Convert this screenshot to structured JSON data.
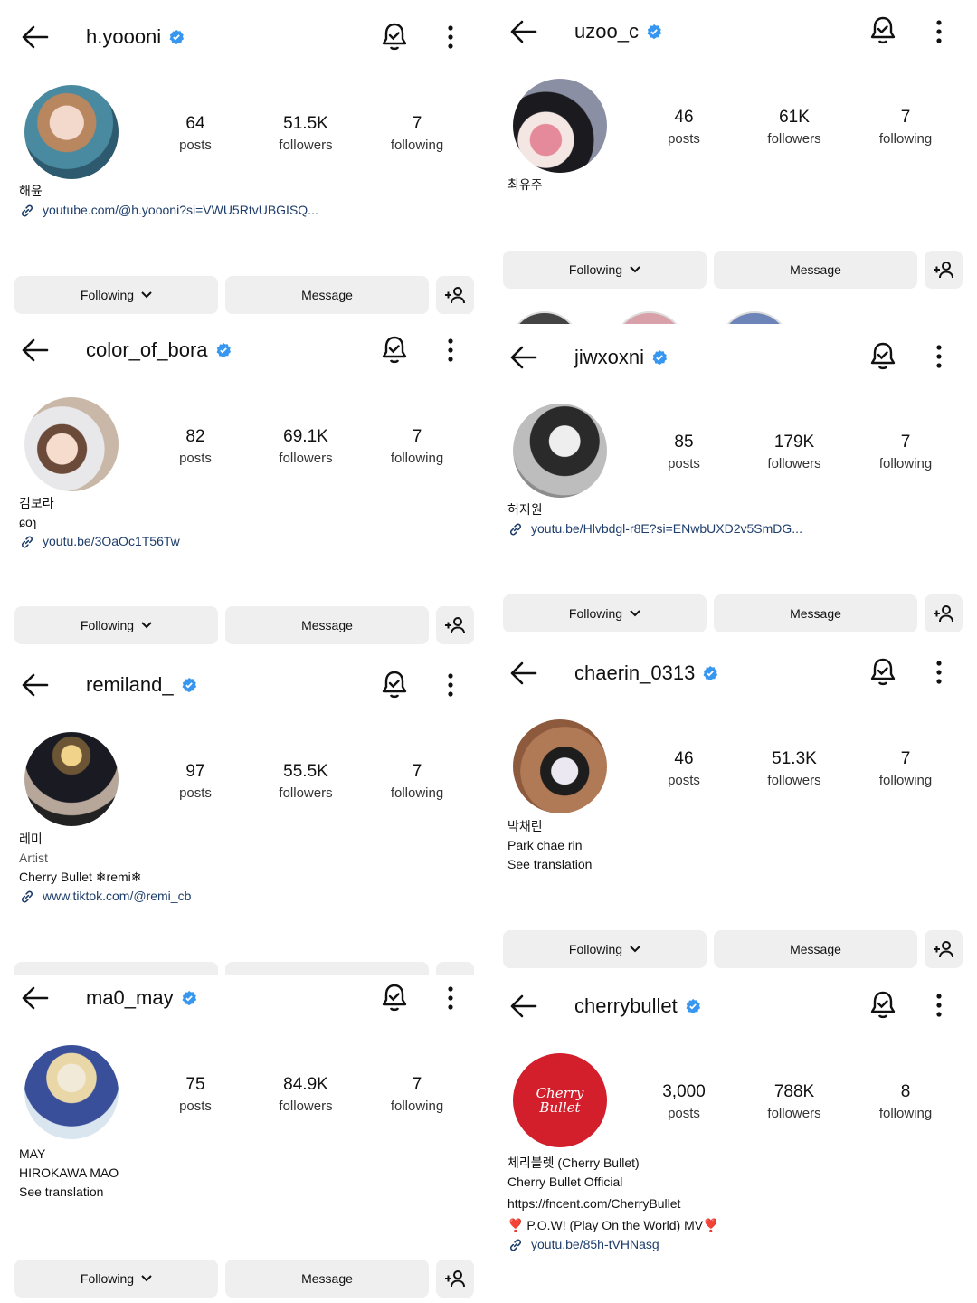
{
  "labels": {
    "posts": "posts",
    "followers": "followers",
    "following": "following",
    "following_btn": "Following",
    "message_btn": "Message"
  },
  "profiles": [
    {
      "username": "h.yoooni",
      "posts": "64",
      "followers": "51.5K",
      "following": "7",
      "bio": [
        "해윤"
      ],
      "link": "youtube.com/@h.yoooni?si=VWU5RtvUBGISQ..."
    },
    {
      "username": "color_of_bora",
      "posts": "82",
      "followers": "69.1K",
      "following": "7",
      "bio": [
        "김보라",
        "ɕoɿ"
      ],
      "link": "youtu.be/3OaOc1T56Tw"
    },
    {
      "username": "remiland_",
      "posts": "97",
      "followers": "55.5K",
      "following": "7",
      "bio": [
        "레미"
      ],
      "category": "Artist",
      "bio2": "Cherry Bullet ❄remi❄",
      "link": "www.tiktok.com/@remi_cb"
    },
    {
      "username": "ma0_may",
      "posts": "75",
      "followers": "84.9K",
      "following": "7",
      "bio": [
        "MAY",
        "HIROKAWA MAO",
        "See translation"
      ]
    },
    {
      "username": "uzoo_c",
      "posts": "46",
      "followers": "61K",
      "following": "7",
      "bio": [
        "최유주"
      ]
    },
    {
      "username": "jiwxoxni",
      "posts": "85",
      "followers": "179K",
      "following": "7",
      "bio": [
        "허지원"
      ],
      "link": "youtu.be/Hlvbdgl-r8E?si=ENwbUXD2v5SmDG..."
    },
    {
      "username": "chaerin_0313",
      "posts": "46",
      "followers": "51.3K",
      "following": "7",
      "bio": [
        "박채린",
        "Park chae rin",
        "See translation"
      ]
    },
    {
      "username": "cherrybullet",
      "posts": "3,000",
      "followers": "788K",
      "following": "8",
      "bio": [
        "체리블렛 (Cherry Bullet)",
        "Cherry Bullet Official",
        "https://fncent.com/CherryBullet",
        "❣️ P.O.W! (Play On the World) MV❣️"
      ],
      "link": "youtu.be/85h-tVHNasg",
      "avatar_logo": "Cherry Bullet"
    }
  ],
  "colors": {
    "verified": "#3797f0",
    "button_bg": "#efefef",
    "link": "#1d3d6b",
    "logo_red": "#d21f2b"
  }
}
